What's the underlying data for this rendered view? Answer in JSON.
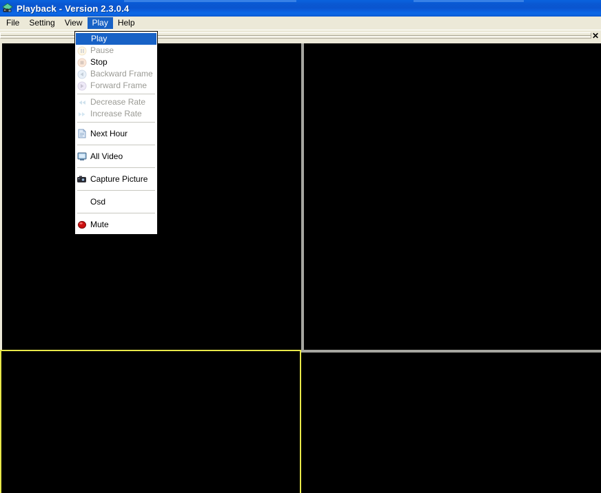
{
  "window": {
    "title": "Playback - Version 2.3.0.4",
    "icon": "playback-app-icon",
    "titlebar_color": "#0a58d2",
    "chrome_color": "#ece9d8"
  },
  "menubar": {
    "items": [
      {
        "label": "File",
        "name": "menubar-item-file",
        "active": false
      },
      {
        "label": "Setting",
        "name": "menubar-item-setting",
        "active": false
      },
      {
        "label": "View",
        "name": "menubar-item-view",
        "active": false
      },
      {
        "label": "Play",
        "name": "menubar-item-play",
        "active": true
      },
      {
        "label": "Help",
        "name": "menubar-item-help",
        "active": false
      }
    ],
    "highlight_color": "#1862c6"
  },
  "toolbar": {
    "close_label": "✕"
  },
  "play_menu": {
    "items": [
      {
        "label": "Play",
        "icon": "play-icon",
        "state": "highlighted"
      },
      {
        "label": "Pause",
        "icon": "pause-icon",
        "state": "disabled"
      },
      {
        "label": "Stop",
        "icon": "stop-icon",
        "state": "enabled"
      },
      {
        "label": "Backward Frame",
        "icon": "backward-frame-icon",
        "state": "disabled"
      },
      {
        "label": "Forward  Frame",
        "icon": "forward-frame-icon",
        "state": "disabled"
      },
      {
        "label": "Decrease Rate",
        "icon": "rewind-icon",
        "state": "disabled"
      },
      {
        "label": "Increase Rate",
        "icon": "fast-forward-icon",
        "state": "disabled"
      },
      {
        "label": "Next Hour",
        "icon": "document-icon",
        "state": "enabled"
      },
      {
        "label": "All Video",
        "icon": "monitor-icon",
        "state": "enabled"
      },
      {
        "label": "Capture Picture",
        "icon": "camera-icon",
        "state": "enabled"
      },
      {
        "label": "Osd",
        "icon": "none",
        "state": "enabled"
      },
      {
        "label": "Mute",
        "icon": "mute-icon",
        "state": "enabled"
      }
    ],
    "selected": "Play"
  },
  "video": {
    "layout": "2x2-quad",
    "background_color": "#000000",
    "divider_color": "#a6a6a0",
    "selected_pane_border_color": "#e8e84a",
    "selected_pane": "bottom-left",
    "panes": [
      {
        "name": "video-pane-1",
        "position": "top-left",
        "selected": false
      },
      {
        "name": "video-pane-2",
        "position": "top-right",
        "selected": false
      },
      {
        "name": "video-pane-3",
        "position": "bottom-left",
        "selected": true
      },
      {
        "name": "video-pane-4",
        "position": "bottom-right",
        "selected": false
      }
    ]
  }
}
